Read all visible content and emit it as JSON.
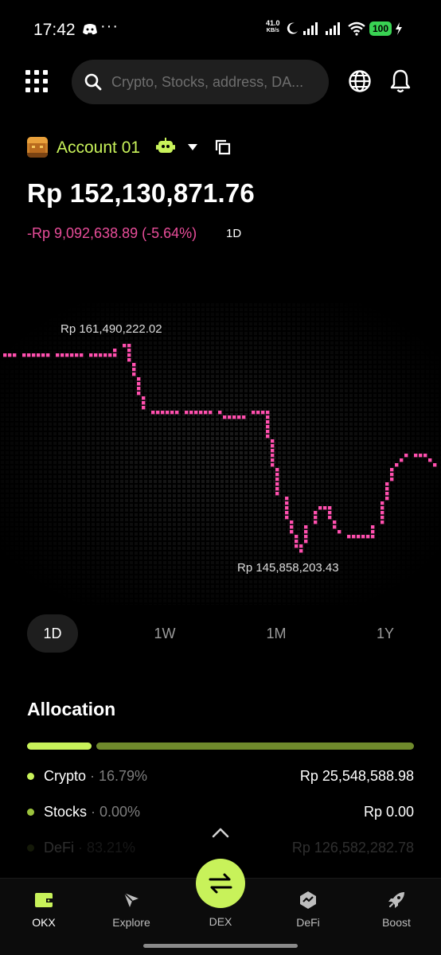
{
  "status_bar": {
    "time": "17:42",
    "dots": "···",
    "speed_value": "41.0",
    "speed_unit": "KB/s",
    "battery": "100"
  },
  "header": {
    "search_placeholder": "Crypto, Stocks, address, DA..."
  },
  "account": {
    "name": "Account 01",
    "balance": "Rp 152,130,871.76",
    "change": "-Rp 9,092,638.89 (-5.64%)",
    "change_period": "1D"
  },
  "chart_data": {
    "type": "line",
    "title": "",
    "xlabel": "",
    "ylabel": "",
    "high_label": "Rp 161,490,222.02",
    "low_label": "Rp 145,858,203.43",
    "high": 161490222.02,
    "low": 145858203.43,
    "series": [
      {
        "values": [
          160940000,
          160940000,
          160940000,
          160940000,
          160940000,
          160940000,
          160940000,
          160940000,
          160940000,
          160940000,
          160940000,
          160940000,
          160940000,
          160940000,
          160940000,
          160940000,
          160940000,
          160940000,
          160940000,
          160940000,
          160940000,
          161490222.02,
          161490222.02,
          160200000,
          159000000,
          157700000,
          156400000,
          156400000,
          156400000,
          156400000,
          156400000,
          156400000,
          156400000,
          156400000,
          156400000,
          156400000,
          156400000,
          156400000,
          156400000,
          156100000,
          156100000,
          156100000,
          156100000,
          156100000,
          156400000,
          156400000,
          156400000,
          156400000,
          154300000,
          152200000,
          150100000,
          148200000,
          147200000,
          145858203.43,
          146800000,
          148200000,
          149100000,
          149100000,
          149100000,
          148200000,
          147600000,
          147200000,
          146900000,
          146900000,
          146900000,
          146900000,
          147200000,
          148200000,
          150100000,
          151600000,
          152400000,
          152900000,
          153100000,
          153100000,
          153100000,
          153100000,
          152900000,
          152600000
        ],
        "color": "#ff4fae"
      }
    ]
  },
  "periods": [
    "1D",
    "1W",
    "1M",
    "1Y"
  ],
  "active_period": "1D",
  "allocation": {
    "title": "Allocation",
    "segments": [
      {
        "fraction": 0.1679,
        "color": "#c8f25a"
      },
      {
        "fraction": 0.0,
        "color": "#9bc23c"
      },
      {
        "fraction": 0.8321,
        "color": "#6f8a2c"
      }
    ],
    "rows": [
      {
        "name": "Crypto",
        "pct": " · 16.79%",
        "value": "Rp 25,548,588.98",
        "color": "#c8f25a"
      },
      {
        "name": "Stocks",
        "pct": " · 0.00%",
        "value": "Rp 0.00",
        "color": "#9bc23c"
      },
      {
        "name": "DeFi",
        "pct": " · 83.21%",
        "value": "Rp 126,582,282.78",
        "color": "#6f8a2c"
      }
    ]
  },
  "nav": {
    "okx": "OKX",
    "explore": "Explore",
    "dex": "DEX",
    "defi": "DeFi",
    "boost": "Boost"
  },
  "icons": {
    "menu": "grid-menu-icon",
    "search": "search-icon",
    "globe": "globe-icon",
    "bell": "bell-icon",
    "bot": "robot-icon",
    "copy": "copy-icon",
    "wallet": "wallet-icon",
    "explore": "compass-icon",
    "swap": "swap-arrows-icon",
    "defi": "defi-icon",
    "boost": "rocket-icon"
  },
  "colors": {
    "accent": "#c8f25a",
    "negative": "#e94d9a",
    "chart_line": "#ff4fae"
  }
}
